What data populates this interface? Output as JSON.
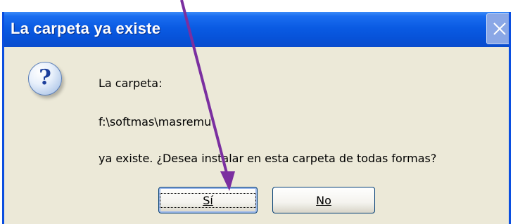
{
  "dialog": {
    "title": "La carpeta ya existe",
    "close_icon": "close-icon",
    "question_icon": "question-icon",
    "message": {
      "line1": "La carpeta:",
      "line2": "f:\\softmas\\masremu",
      "line3": "ya existe. ¿Desea instalar en esta carpeta de todas formas?"
    },
    "buttons": {
      "yes_label": "Sí",
      "no_label": "No"
    }
  },
  "annotation": {
    "arrow_icon": "arrow-pointer-icon",
    "arrow_color": "#7b2fa0"
  },
  "colors": {
    "titlebar_blue": "#0a5be3",
    "dialog_bg": "#ece9d8"
  }
}
